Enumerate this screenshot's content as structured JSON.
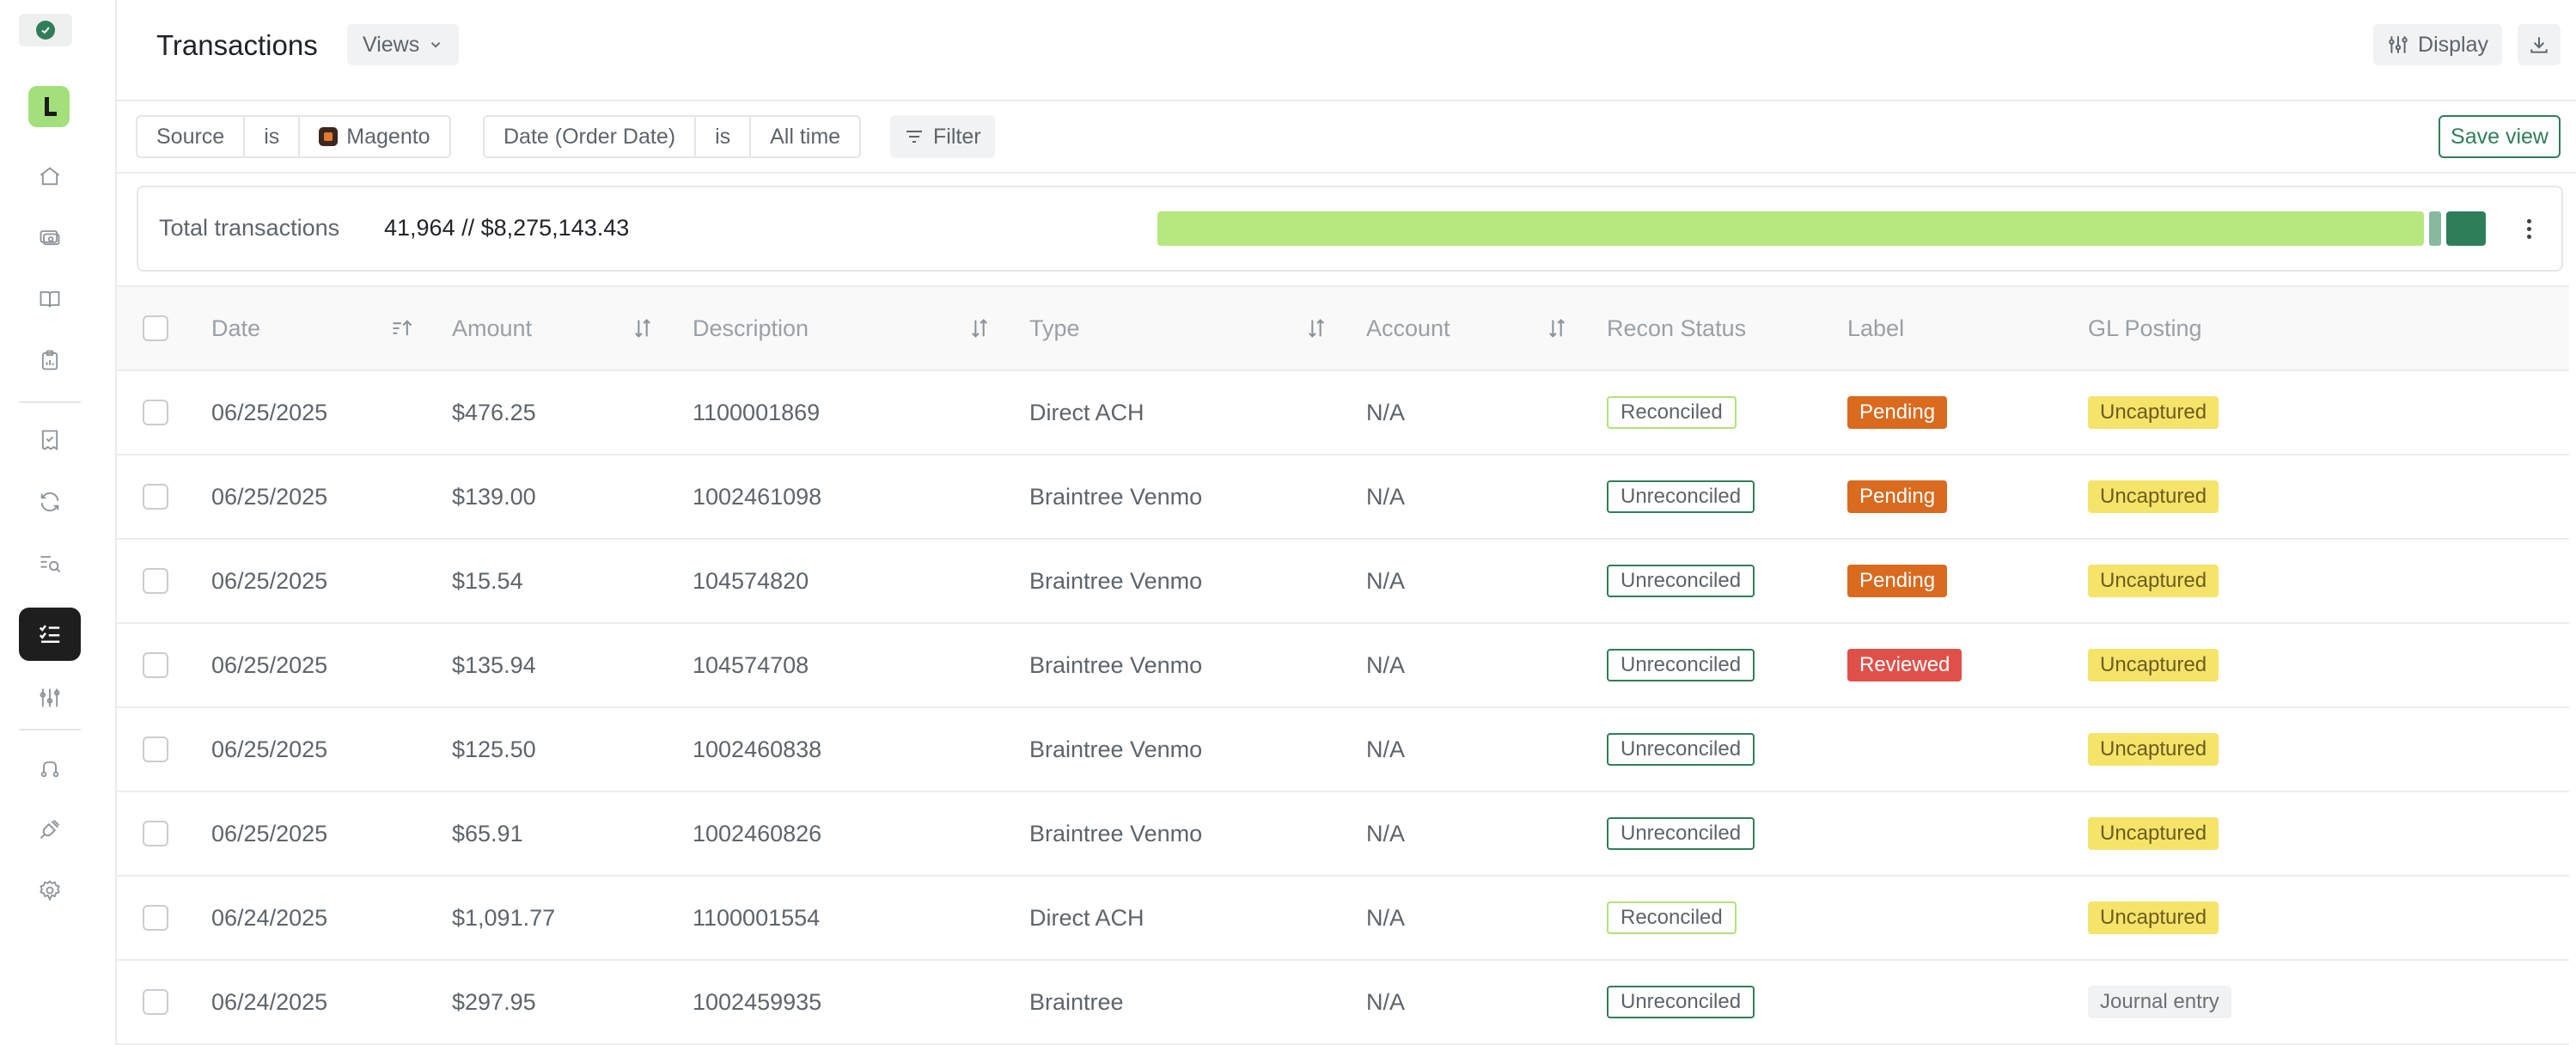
{
  "header": {
    "title": "Transactions",
    "views_label": "Views",
    "display_label": "Display"
  },
  "filters": [
    {
      "field": "Source",
      "operator": "is",
      "value": "Magento",
      "value_icon": "magento-icon"
    },
    {
      "field": "Date (Order Date)",
      "operator": "is",
      "value": "All time"
    }
  ],
  "filter_button": "Filter",
  "save_view": "Save view",
  "summary": {
    "label": "Total transactions",
    "value": "41,964 // $8,275,143.43",
    "bar_colors": [
      "#b7e87f",
      "#86b9a0",
      "#2f7e5a"
    ]
  },
  "sidebar": {
    "items": [
      {
        "name": "home-icon"
      },
      {
        "name": "payments-icon"
      },
      {
        "name": "book-icon"
      },
      {
        "name": "clipboard-chart-icon"
      },
      {
        "name": "receipt-check-icon"
      },
      {
        "name": "sync-icon"
      },
      {
        "name": "search-list-icon"
      },
      {
        "name": "transactions-list-icon",
        "active": true
      },
      {
        "name": "sliders-icon"
      },
      {
        "name": "workflow-icon"
      },
      {
        "name": "plug-icon"
      },
      {
        "name": "settings-icon"
      }
    ]
  },
  "table": {
    "columns": [
      "Date",
      "Amount",
      "Description",
      "Type",
      "Account",
      "Recon Status",
      "Label",
      "GL Posting"
    ],
    "rows": [
      {
        "date": "06/25/2025",
        "amount": "$476.25",
        "description": "1100001869",
        "type": "Direct ACH",
        "account": "N/A",
        "recon": "Reconciled",
        "label": "Pending",
        "gl": "Uncaptured"
      },
      {
        "date": "06/25/2025",
        "amount": "$139.00",
        "description": "1002461098",
        "type": "Braintree Venmo",
        "account": "N/A",
        "recon": "Unreconciled",
        "label": "Pending",
        "gl": "Uncaptured"
      },
      {
        "date": "06/25/2025",
        "amount": "$15.54",
        "description": "104574820",
        "type": "Braintree Venmo",
        "account": "N/A",
        "recon": "Unreconciled",
        "label": "Pending",
        "gl": "Uncaptured"
      },
      {
        "date": "06/25/2025",
        "amount": "$135.94",
        "description": "104574708",
        "type": "Braintree Venmo",
        "account": "N/A",
        "recon": "Unreconciled",
        "label": "Reviewed",
        "gl": "Uncaptured"
      },
      {
        "date": "06/25/2025",
        "amount": "$125.50",
        "description": "1002460838",
        "type": "Braintree Venmo",
        "account": "N/A",
        "recon": "Unreconciled",
        "label": "",
        "gl": "Uncaptured"
      },
      {
        "date": "06/25/2025",
        "amount": "$65.91",
        "description": "1002460826",
        "type": "Braintree Venmo",
        "account": "N/A",
        "recon": "Unreconciled",
        "label": "",
        "gl": "Uncaptured"
      },
      {
        "date": "06/24/2025",
        "amount": "$1,091.77",
        "description": "1100001554",
        "type": "Direct ACH",
        "account": "N/A",
        "recon": "Reconciled",
        "label": "",
        "gl": "Uncaptured"
      },
      {
        "date": "06/24/2025",
        "amount": "$297.95",
        "description": "1002459935",
        "type": "Braintree",
        "account": "N/A",
        "recon": "Unreconciled",
        "label": "",
        "gl": "Journal entry"
      }
    ]
  }
}
